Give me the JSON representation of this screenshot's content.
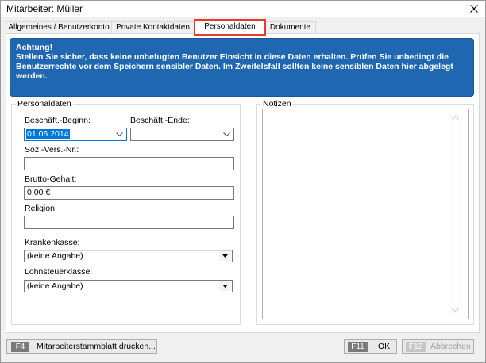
{
  "window": {
    "title": "Mitarbeiter: Müller"
  },
  "tabs": [
    {
      "label": "Allgemeines / Benutzerkonto",
      "selected": false
    },
    {
      "label": "Private Kontaktdaten",
      "selected": false
    },
    {
      "label": "Personaldaten",
      "selected": true
    },
    {
      "label": "Dokumente",
      "selected": false
    }
  ],
  "warning": {
    "heading": "Achtung!",
    "text": "Stellen Sie sicher, dass keine unbefugten Benutzer Einsicht in diese Daten erhalten. Prüfen Sie unbedingt die Benutzerrechte vor dem Speichern sensibler Daten. Im Zweifelsfall sollten keine sensiblen Daten hier abgelegt werden."
  },
  "personaldaten": {
    "group_label": "Personaldaten",
    "beginn": {
      "label": "Beschäft.-Beginn:",
      "value": "01.06.2014"
    },
    "ende": {
      "label": "Beschäft.-Ende:",
      "value": ""
    },
    "sozvers": {
      "label": "Soz.-Vers.-Nr.:",
      "value": ""
    },
    "gehalt": {
      "label": "Brutto-Gehalt:",
      "value": "0,00 €"
    },
    "religion": {
      "label": "Religion:",
      "value": ""
    },
    "krankenkasse": {
      "label": "Krankenkasse:",
      "selected": "(keine Angabe)"
    },
    "lohnsteuerklasse": {
      "label": "Lohnsteuerklasse:",
      "selected": "(keine Angabe)"
    }
  },
  "notizen": {
    "group_label": "Notizen",
    "value": ""
  },
  "footer": {
    "print_button": {
      "key": "F4",
      "label": "Mitarbeiterstammblatt drucken...",
      "enabled": true
    },
    "ok_button": {
      "key": "F11",
      "label": "OK",
      "enabled": true
    },
    "cancel_button": {
      "key": "F12",
      "label": "Abbrechen",
      "enabled": false
    }
  },
  "icons": {
    "close": "close-icon",
    "date_dropdown": "chevron-down-icon",
    "select_dropdown": "triangle-down-icon",
    "scroll_up": "chevron-up-icon",
    "scroll_down": "chevron-down-icon"
  },
  "colors": {
    "warning_banner": "#1f67b1",
    "text_selection": "#0078d7",
    "focus_border": "#0078d7",
    "annotation_highlight": "#e8392b",
    "window_background": "#f0f0f0"
  }
}
